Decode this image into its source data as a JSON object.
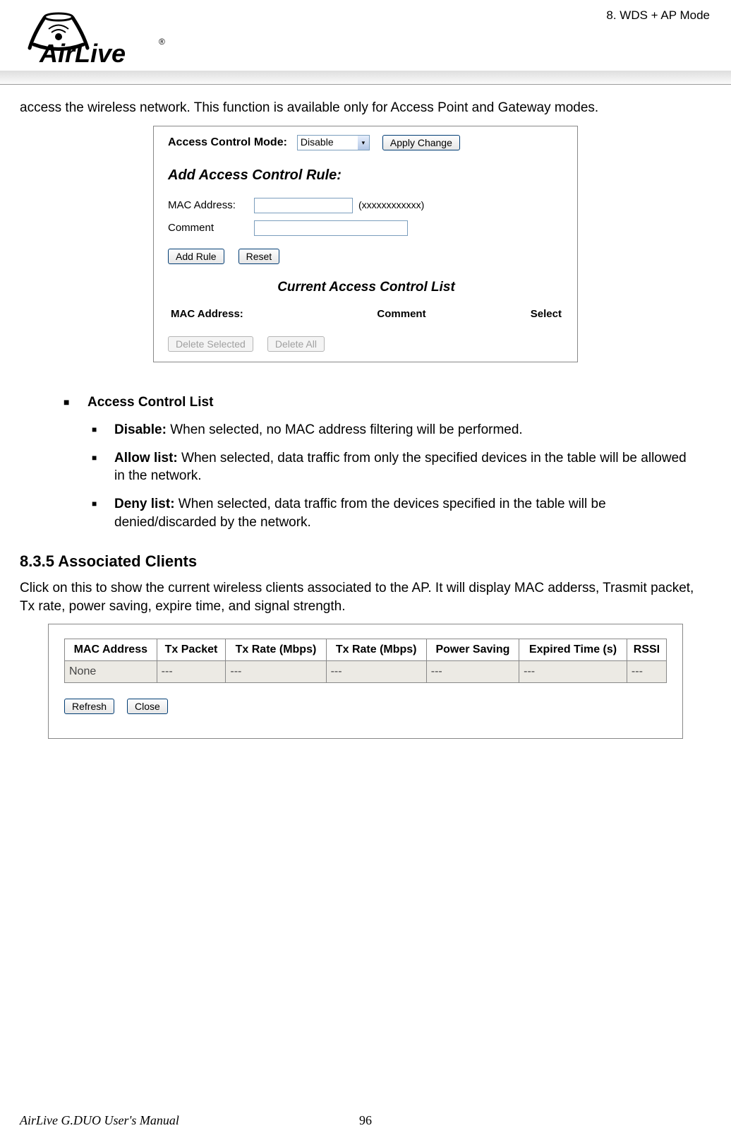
{
  "chapter": "8.  WDS  +  AP  Mode",
  "logo_text": "AirLive",
  "logo_reg": "®",
  "intro": "access the wireless network.    This function is available only for Access Point and Gateway modes.",
  "dialog1": {
    "mode_label": "Access Control Mode:",
    "mode_value": "Disable",
    "apply_btn": "Apply Change",
    "heading_add": "Add Access Control Rule:",
    "mac_label": "MAC Address:",
    "mac_hint": "(xxxxxxxxxxxx)",
    "comment_label": "Comment",
    "add_btn": "Add Rule",
    "reset_btn": "Reset",
    "heading_list": "Current Access Control List",
    "col_mac": "MAC Address:",
    "col_comment": "Comment",
    "col_select": "Select",
    "del_sel_btn": "Delete Selected",
    "del_all_btn": "Delete All"
  },
  "bullets": {
    "title": "Access Control List",
    "disable_lbl": "Disable:",
    "disable_text": " When selected, no MAC address filtering will be performed.",
    "allow_lbl": "Allow list:",
    "allow_text": " When selected, data traffic from only the specified devices in the table will be allowed in the network.",
    "deny_lbl": "Deny list:",
    "deny_text": " When selected, data traffic from the devices specified in the table will be denied/discarded by the network."
  },
  "section_835": {
    "heading": "8.3.5 Associated Clients",
    "text": "Click on this to show the current wireless clients associated to the AP.    It will display MAC adderss, Trasmit packet, Tx rate, power saving, expire time, and signal strength."
  },
  "dialog2": {
    "cols": [
      "MAC Address",
      "Tx Packet",
      "Tx Rate (Mbps)",
      "Tx Rate (Mbps)",
      "Power Saving",
      "Expired Time (s)",
      "RSSI"
    ],
    "row": [
      "None",
      "---",
      "---",
      "---",
      "---",
      "---",
      "---"
    ],
    "refresh_btn": "Refresh",
    "close_btn": "Close"
  },
  "footer": {
    "manual": "AirLive G.DUO User's Manual",
    "page": "96"
  }
}
